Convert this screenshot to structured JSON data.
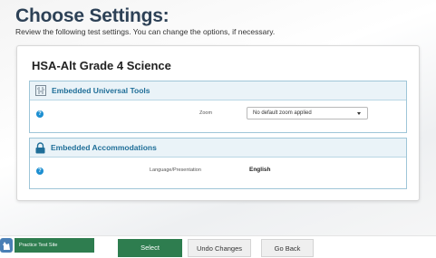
{
  "header": {
    "title": "Choose Settings:",
    "subtitle": "Review the following test settings. You can change the options, if necessary."
  },
  "test": {
    "name": "HSA-Alt Grade 4 Science"
  },
  "sections": {
    "tools": {
      "title": "Embedded Universal Tools",
      "zoom_label": "Zoom",
      "zoom_value": "No default zoom applied"
    },
    "accommodations": {
      "title": "Embedded Accommodations",
      "language_label": "Language/Presentation",
      "language_value": "English"
    }
  },
  "footer": {
    "practice_site": "Practice Test Site",
    "select": "Select",
    "undo": "Undo Changes",
    "back": "Go Back"
  },
  "colors": {
    "title": "#2d4156",
    "section_accent": "#1f6e98",
    "primary_button": "#2e7d4f"
  },
  "icons": {
    "tools": "tools-grid-icon",
    "accommodations": "lock-icon",
    "info": "info-icon",
    "practice": "practice-icon"
  }
}
